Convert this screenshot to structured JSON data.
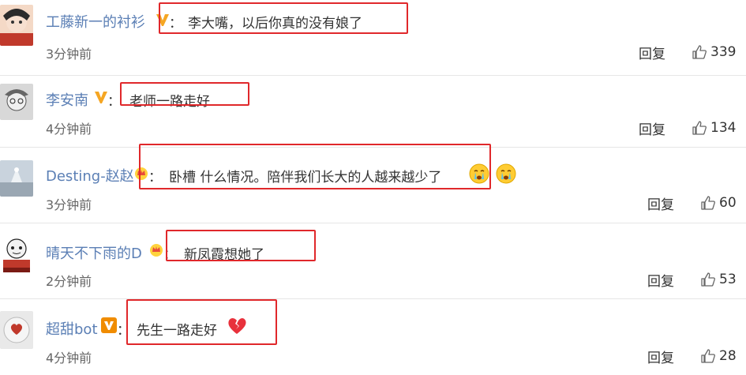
{
  "comments": [
    {
      "name": "工藤新一的衬衫",
      "badge": "yellow-v",
      "text": "李大嘴，以后你真的没有娘了",
      "time": "3分钟前",
      "reply": "回复",
      "likes": "339"
    },
    {
      "name": "李安南",
      "badge": "yellow-v",
      "text": "老师一路走好",
      "time": "4分钟前",
      "reply": "回复",
      "likes": "134"
    },
    {
      "name": "Desting-赵赵",
      "badge": "crown",
      "text": "卧槽 什么情况。陪伴我们长大的人越来越少了",
      "emoji": [
        "crying-face",
        "crying-face"
      ],
      "time": "3分钟前",
      "reply": "回复",
      "likes": "60"
    },
    {
      "name": "晴天不下雨的D",
      "badge": "crown",
      "text": "新凤霞想她了",
      "time": "2分钟前",
      "reply": "回复",
      "likes": "53"
    },
    {
      "name": "超甜bot",
      "badge": "orange-v",
      "text": "先生一路走好",
      "emoji": [
        "broken-heart"
      ],
      "time": "4分钟前",
      "reply": "回复",
      "likes": "28"
    }
  ],
  "colon": "：",
  "colors": {
    "username": "#5b7fb5",
    "highlight_box": "#e0282b",
    "time": "#666666"
  }
}
